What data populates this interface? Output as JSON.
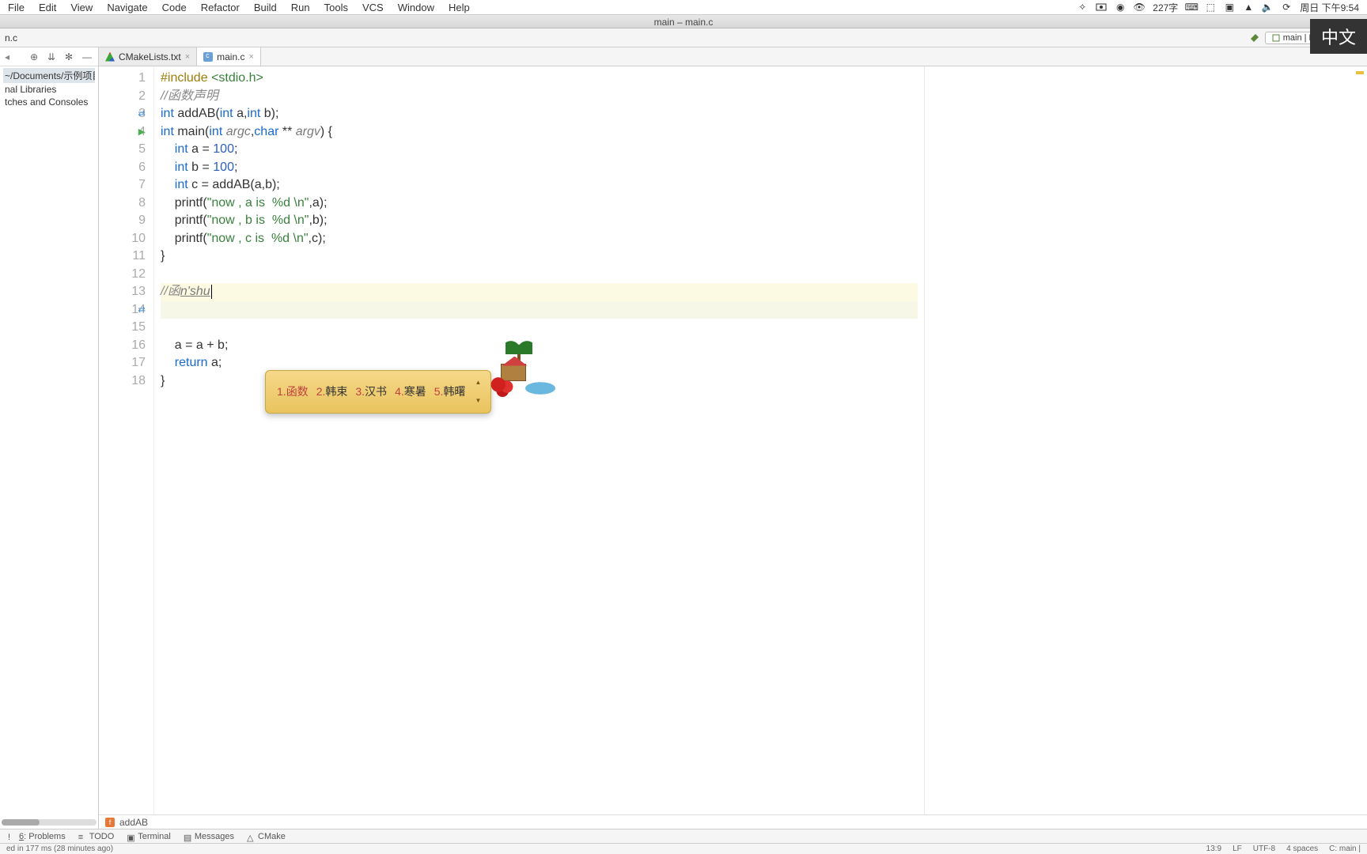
{
  "menubar": {
    "items": [
      "File",
      "Edit",
      "View",
      "Navigate",
      "Code",
      "Refactor",
      "Build",
      "Run",
      "Tools",
      "VCS",
      "Window",
      "Help"
    ],
    "sys_charcount": "227字",
    "sys_clock": "周日 下午9:54"
  },
  "window": {
    "title": "main – main.c"
  },
  "toolbar": {
    "breadcrumb": "n.c",
    "run_config": "main | Debug"
  },
  "sidebar": {
    "toolbar_icons": [
      "target",
      "collapse",
      "settings",
      "hide"
    ],
    "header": "~/Documents/示例项目",
    "items": [
      "nal Libraries",
      "tches and Consoles"
    ]
  },
  "tabs": [
    {
      "label": "CMakeLists.txt",
      "icon": "cmake",
      "active": false
    },
    {
      "label": "main.c",
      "icon": "c",
      "active": true
    }
  ],
  "code": {
    "lines": [
      {
        "n": 1,
        "html": "<span class='pp'>#include</span> <span class='inc'>&lt;stdio.h&gt;</span>"
      },
      {
        "n": 2,
        "html": "<span class='cm'>//函数声明</span>"
      },
      {
        "n": 3,
        "html": "<span class='kw'>int</span> addAB(<span class='kw'>int</span> a,<span class='kw'>int</span> b);",
        "gicon": "sync"
      },
      {
        "n": 4,
        "html": "<span class='kw'>int</span> main(<span class='kw'>int</span> <span class='pr'>argc</span>,<span class='kw'>char</span> ** <span class='pr'>argv</span>) {",
        "gicon": "run"
      },
      {
        "n": 5,
        "html": "    <span class='kw'>int</span> a = <span class='num'>100</span>;"
      },
      {
        "n": 6,
        "html": "    <span class='kw'>int</span> b = <span class='num'>100</span>;"
      },
      {
        "n": 7,
        "html": "    <span class='kw'>int</span> c = addAB(a,b);"
      },
      {
        "n": 8,
        "html": "    printf(<span class='str'>\"now , a is  %d \\n\"</span>,a);"
      },
      {
        "n": 9,
        "html": "    printf(<span class='str'>\"now , b is  %d \\n\"</span>,b);"
      },
      {
        "n": 10,
        "html": "    printf(<span class='str'>\"now , c is  %d \\n\"</span>,c);"
      },
      {
        "n": 11,
        "html": "}"
      },
      {
        "n": 12,
        "html": ""
      },
      {
        "n": 13,
        "html": "<span class='cm'>//函<span class='ime-input'>n'shu</span></span><span class='caret'></span>",
        "hl": true
      },
      {
        "n": 14,
        "html": "",
        "gicon": "sync",
        "hl2": true
      },
      {
        "n": 15,
        "html": ""
      },
      {
        "n": 16,
        "html": "    a = a + b;"
      },
      {
        "n": 17,
        "html": "    <span class='kw'>return</span> a;"
      },
      {
        "n": 18,
        "html": "}"
      }
    ]
  },
  "ime": {
    "candidates": [
      {
        "idx": "1.",
        "text": "函数",
        "sel": true
      },
      {
        "idx": "2.",
        "text": "韩束"
      },
      {
        "idx": "3.",
        "text": "汉书"
      },
      {
        "idx": "4.",
        "text": "寒暑"
      },
      {
        "idx": "5.",
        "text": "韩曙"
      }
    ]
  },
  "ime_indicator": "中文",
  "breadcrumb": {
    "icon": "f",
    "label": "addAB"
  },
  "bottom_tabs": [
    {
      "icon": "!",
      "label": "6: Problems",
      "u": true
    },
    {
      "icon": "≡",
      "label": "TODO"
    },
    {
      "icon": "▣",
      "label": "Terminal"
    },
    {
      "icon": "▤",
      "label": "Messages"
    },
    {
      "icon": "△",
      "label": "CMake"
    }
  ],
  "statusbar": {
    "left": "ed in 177 ms (28 minutes ago)",
    "pos": "13:9",
    "eol": "LF",
    "enc": "UTF-8",
    "indent": "4 spaces",
    "ctx": "C: main |"
  }
}
